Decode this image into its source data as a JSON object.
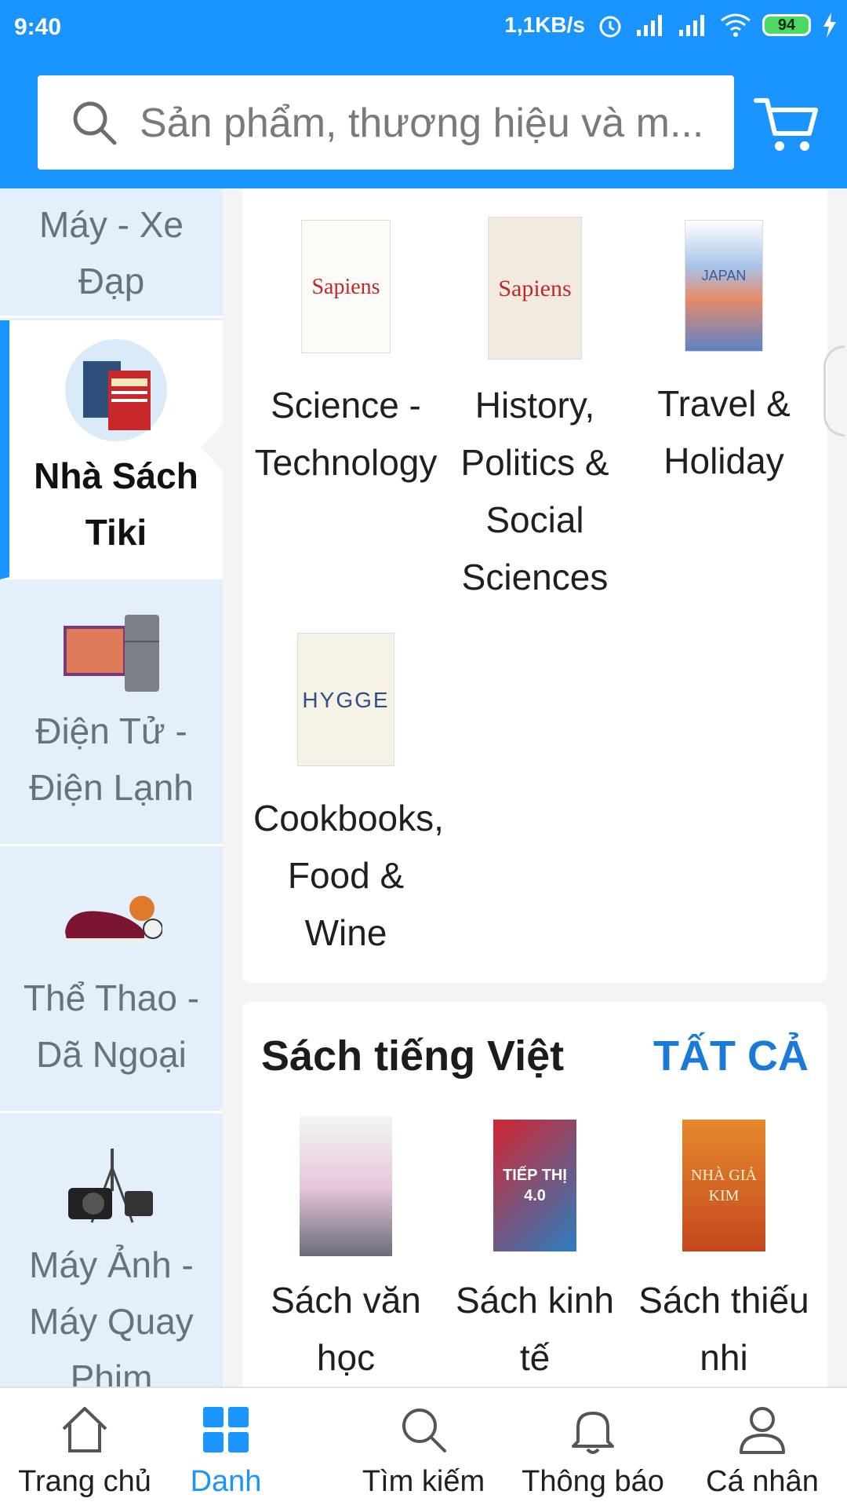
{
  "status_bar": {
    "time": "9:40",
    "speed": "1,1KB/s",
    "battery": "94"
  },
  "search": {
    "placeholder": "Sản phẩm, thương hiệu và m..."
  },
  "sidebar": {
    "items": [
      {
        "label": "Máy - Xe Đạp"
      },
      {
        "label": "Nhà Sách Tiki"
      },
      {
        "label": "Điện Tử - Điện Lạnh"
      },
      {
        "label": "Thể Thao - Dã Ngoại"
      },
      {
        "label": "Máy Ảnh - Máy Quay Phim"
      }
    ]
  },
  "english_books": {
    "items": [
      {
        "label": "Science - Technology",
        "cover_title": "Sapiens"
      },
      {
        "label": "History, Politics & Social Sciences",
        "cover_title": "Sapiens"
      },
      {
        "label": "Travel & Holiday",
        "cover_title": "JAPAN"
      },
      {
        "label": "Cookbooks, Food & Wine",
        "cover_title": "HYGGE"
      }
    ]
  },
  "vietnamese_books": {
    "title": "Sách tiếng Việt",
    "see_all": "TẤT CẢ",
    "items": [
      {
        "label": "Sách văn học"
      },
      {
        "label": "Sách kinh tế",
        "cover_title": "TIẾP THỊ 4.0"
      },
      {
        "label": "Sách thiếu nhi",
        "cover_title": "NHÀ GIẢ KIM"
      }
    ]
  },
  "bottom_nav": [
    {
      "label": "Trang chủ"
    },
    {
      "label": "Danh"
    },
    {
      "label": "Tìm kiếm"
    },
    {
      "label": "Thông báo"
    },
    {
      "label": "Cá nhân"
    }
  ],
  "colors": {
    "brand": "#1a94ff",
    "link": "#1a7ad8",
    "sidebar_bg": "#e3f0fb"
  }
}
